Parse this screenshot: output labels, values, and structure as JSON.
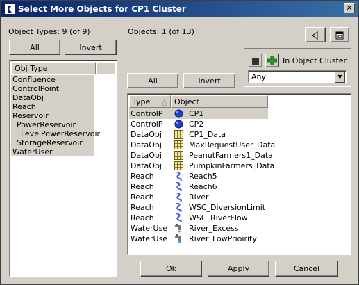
{
  "window": {
    "title": "Select More Objects for CP1 Cluster",
    "close_glyph": "✕"
  },
  "left_panel": {
    "types_label": "Object Types: 9 (of 9)",
    "all_label": "All",
    "invert_label": "Invert",
    "column_header": "Obj Type",
    "items": [
      "Confluence",
      "ControlPoint",
      "DataObj",
      "Reach",
      "Reservoir",
      "PowerReservoir",
      "LevelPowerReservoir",
      "StorageReservoir",
      "WaterUser"
    ]
  },
  "right_panel": {
    "objects_label": "Objects: 1 (of 13)",
    "all_label": "All",
    "invert_label": "Invert",
    "cluster_label": "In Object Cluster",
    "cluster_filter_value": "Any",
    "col_type": "Type",
    "col_object": "Object",
    "rows": [
      {
        "type": "ControlP",
        "name": "CP1",
        "icon": "control-point-icon"
      },
      {
        "type": "ControlP",
        "name": "CP2",
        "icon": "control-point-icon"
      },
      {
        "type": "DataObj",
        "name": "CP1_Data",
        "icon": "data-object-icon"
      },
      {
        "type": "DataObj",
        "name": "MaxRequestUser_Data",
        "icon": "data-object-icon"
      },
      {
        "type": "DataObj",
        "name": "PeanutFarmers1_Data",
        "icon": "data-object-icon"
      },
      {
        "type": "DataObj",
        "name": "PumpkinFarmers_Data",
        "icon": "data-object-icon"
      },
      {
        "type": "Reach",
        "name": "Reach5",
        "icon": "reach-icon"
      },
      {
        "type": "Reach",
        "name": "Reach6",
        "icon": "reach-icon"
      },
      {
        "type": "Reach",
        "name": "River",
        "icon": "reach-icon"
      },
      {
        "type": "Reach",
        "name": "WSC_DiversionLimit",
        "icon": "reach-icon"
      },
      {
        "type": "Reach",
        "name": "WSC_RiverFlow",
        "icon": "reach-icon"
      },
      {
        "type": "WaterUse",
        "name": "River_Excess",
        "icon": "water-user-icon"
      },
      {
        "type": "WaterUse",
        "name": "River_LowPrioirity",
        "icon": "water-user-icon"
      }
    ]
  },
  "footer": {
    "ok_label": "Ok",
    "apply_label": "Apply",
    "cancel_label": "Cancel"
  }
}
